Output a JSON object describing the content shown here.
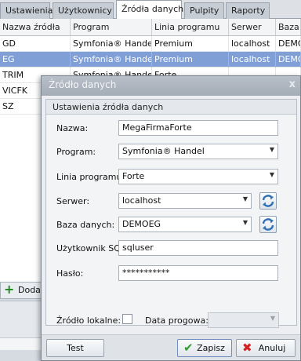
{
  "tabs": [
    "Ustawienia",
    "Użytkownicy",
    "Źródła danych",
    "Pulpity",
    "Raporty"
  ],
  "grid": {
    "columns": [
      "Nazwa źródła",
      "Program",
      "Linia programu",
      "Serwer",
      "Baza"
    ],
    "rows": [
      [
        "GD",
        "Symfonia® Handel",
        "Premium",
        "localhost",
        "DEMO"
      ],
      [
        "EG",
        "Symfonia® Handel",
        "Premium",
        "localhost",
        "DEMO"
      ],
      [
        "TRIM",
        "Symfonia® Handel",
        "Forte",
        "",
        ""
      ],
      [
        "VICFK",
        "",
        "",
        "",
        ""
      ],
      [
        "SZ",
        "",
        "",
        "",
        ""
      ]
    ],
    "selected_row": 1
  },
  "add_button": "Doda",
  "dialog": {
    "title": "Źródło danych",
    "close": "x",
    "group_title": "Ustawienia źródła danych",
    "fields": {
      "name": {
        "label": "Nazwa:",
        "value": "MegaFirmaForte"
      },
      "program": {
        "label": "Program:",
        "value": "Symfonia® Handel"
      },
      "line": {
        "label": "Linia programu:",
        "value": "Forte"
      },
      "server": {
        "label": "Serwer:",
        "value": "localhost"
      },
      "database": {
        "label": "Baza danych:",
        "value": "DEMOEG"
      },
      "sql_user": {
        "label": "Użytkownik SQL:",
        "value": "sqluser"
      },
      "password": {
        "label": "Hasło:",
        "value": "***********"
      }
    },
    "local_source": {
      "label": "Źródło lokalne:",
      "checked": false
    },
    "date_threshold": {
      "label": "Data progowa:",
      "value": ""
    },
    "buttons": {
      "test": "Test",
      "save": "Zapisz",
      "cancel": "Anuluj"
    }
  },
  "icons": {
    "refresh": "refresh-icon",
    "save": "checkmark-icon",
    "cancel": "cross-icon",
    "add": "plus-icon",
    "dropdown": "chevron-down-icon"
  },
  "colors": {
    "selected_row": "#7f9fd6",
    "save_check": "#2f9d2f",
    "cancel_cross": "#d42020",
    "add_plus": "#1e8a1e",
    "refresh_icon": "#2f6fb5"
  }
}
